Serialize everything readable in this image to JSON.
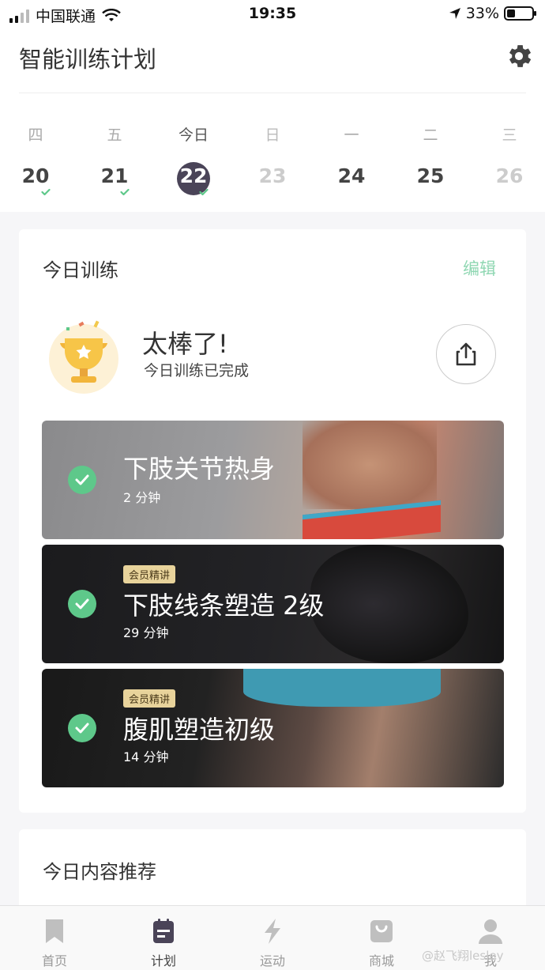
{
  "status_bar": {
    "carrier": "中国联通",
    "time": "19:35",
    "battery": "33%",
    "battery_level": 0.33
  },
  "header": {
    "title": "智能训练计划",
    "settings_icon": "gear-icon"
  },
  "week": [
    {
      "weekday": "四",
      "date": "20",
      "state": "done"
    },
    {
      "weekday": "五",
      "date": "21",
      "state": "done"
    },
    {
      "weekday": "今日",
      "date": "22",
      "state": "today-done"
    },
    {
      "weekday": "日",
      "date": "23",
      "state": "future"
    },
    {
      "weekday": "一",
      "date": "24",
      "state": "upcoming"
    },
    {
      "weekday": "二",
      "date": "25",
      "state": "upcoming"
    },
    {
      "weekday": "三",
      "date": "26",
      "state": "future"
    }
  ],
  "today_card": {
    "title": "今日训练",
    "edit_label": "编辑",
    "congrats": "太棒了!",
    "completed_text": "今日训练已完成",
    "share_icon": "share-icon"
  },
  "workouts": [
    {
      "name": "下肢关节热身",
      "duration": "2 分钟",
      "tag": "",
      "completed": true
    },
    {
      "name": "下肢线条塑造 2级",
      "duration": "29 分钟",
      "tag": "会员精讲",
      "completed": true
    },
    {
      "name": "腹肌塑造初级",
      "duration": "14 分钟",
      "tag": "会员精讲",
      "completed": true
    }
  ],
  "recommend_card": {
    "title": "今日内容推荐"
  },
  "tabs": [
    {
      "label": "首页",
      "icon": "bookmark-icon",
      "active": false
    },
    {
      "label": "计划",
      "icon": "plan-icon",
      "active": true
    },
    {
      "label": "运动",
      "icon": "lightning-icon",
      "active": false
    },
    {
      "label": "商城",
      "icon": "shopping-bag-icon",
      "active": false
    },
    {
      "label": "我",
      "icon": "user-icon",
      "active": false
    }
  ],
  "watermark": "@赵飞翔lesley",
  "colors": {
    "accent_green": "#5ec88a",
    "edit_green": "#8fd7b2",
    "today_circle": "#4a4458",
    "tag_gold": "#e8d39b"
  }
}
